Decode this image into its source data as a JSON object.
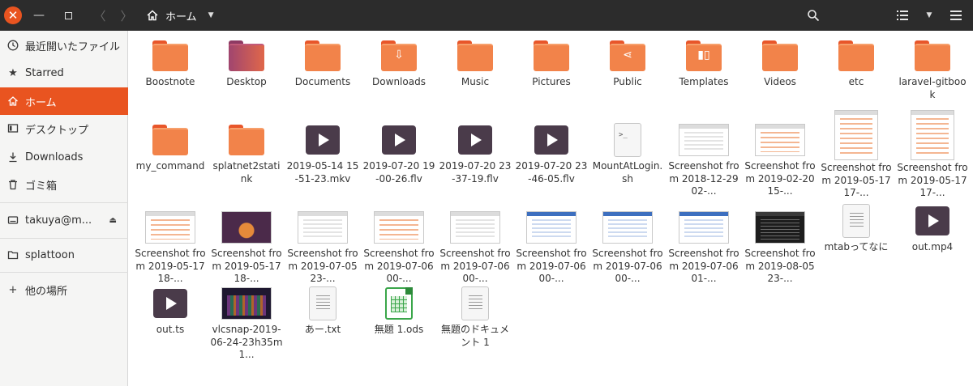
{
  "header": {
    "close_glyph": "✕",
    "minimize_glyph": "—",
    "back_glyph": "〈",
    "forward_glyph": "〉",
    "location_label": "ホーム",
    "location_caret": "▼",
    "view_caret": "▼"
  },
  "sidebar": {
    "items": [
      {
        "label": "最近開いたファイル",
        "icon": "recent-icon"
      },
      {
        "label": "Starred",
        "icon": "star-icon"
      },
      {
        "label": "ホーム",
        "icon": "home-icon",
        "active": true
      },
      {
        "label": "デスクトップ",
        "icon": "desktop-icon"
      },
      {
        "label": "Downloads",
        "icon": "download-icon"
      },
      {
        "label": "ゴミ箱",
        "icon": "trash-icon"
      },
      {
        "label": "takuya@m...",
        "icon": "drive-icon"
      },
      {
        "label": "splattoon",
        "icon": "folder-icon"
      },
      {
        "label": "他の場所",
        "icon": "plus-icon"
      }
    ],
    "eject_glyph": "⏏"
  },
  "files": [
    {
      "name": "Boostnote",
      "kind": "folder"
    },
    {
      "name": "Desktop",
      "kind": "folder-desktop"
    },
    {
      "name": "Documents",
      "kind": "folder"
    },
    {
      "name": "Downloads",
      "kind": "folder-download"
    },
    {
      "name": "Music",
      "kind": "folder-music"
    },
    {
      "name": "Pictures",
      "kind": "folder-pictures"
    },
    {
      "name": "Public",
      "kind": "folder-share"
    },
    {
      "name": "Templates",
      "kind": "folder-templates"
    },
    {
      "name": "Videos",
      "kind": "folder"
    },
    {
      "name": "etc",
      "kind": "folder"
    },
    {
      "name": "laravel-gitbook",
      "kind": "folder"
    },
    {
      "name": "my_command",
      "kind": "folder"
    },
    {
      "name": "splatnet2statink",
      "kind": "folder"
    },
    {
      "name": "2019-05-14 15-51-23.mkv",
      "kind": "video"
    },
    {
      "name": "2019-07-20 19-00-26.flv",
      "kind": "video"
    },
    {
      "name": "2019-07-20 23-37-19.flv",
      "kind": "video"
    },
    {
      "name": "2019-07-20 23-46-05.flv",
      "kind": "video"
    },
    {
      "name": "MountAtLogin.sh",
      "kind": "script"
    },
    {
      "name": "Screenshot from 2018-12-29 02-...",
      "kind": "shot"
    },
    {
      "name": "Screenshot from 2019-02-20 15-...",
      "kind": "shot-orange"
    },
    {
      "name": "Screenshot from 2019-05-17 17-...",
      "kind": "shot-tall"
    },
    {
      "name": "Screenshot from 2019-05-17 17-...",
      "kind": "shot-tall"
    },
    {
      "name": "Screenshot from 2019-05-17 18-...",
      "kind": "shot-orange"
    },
    {
      "name": "Screenshot from 2019-05-17 18-...",
      "kind": "shot-purple"
    },
    {
      "name": "Screenshot from 2019-07-05 23-...",
      "kind": "shot"
    },
    {
      "name": "Screenshot from 2019-07-06 00-...",
      "kind": "shot-orange"
    },
    {
      "name": "Screenshot from 2019-07-06 00-...",
      "kind": "shot"
    },
    {
      "name": "Screenshot from 2019-07-06 00-...",
      "kind": "shot-blue"
    },
    {
      "name": "Screenshot from 2019-07-06 00-...",
      "kind": "shot-blue"
    },
    {
      "name": "Screenshot from 2019-07-06 01-...",
      "kind": "shot-blue"
    },
    {
      "name": "Screenshot from 2019-08-05 23-...",
      "kind": "shot-dark"
    },
    {
      "name": "mtabってなに",
      "kind": "doc"
    },
    {
      "name": "out.mp4",
      "kind": "video"
    },
    {
      "name": "out.ts",
      "kind": "video"
    },
    {
      "name": "vlcsnap-2019-06-24-23h35m1...",
      "kind": "shot-game"
    },
    {
      "name": "あー.txt",
      "kind": "doc"
    },
    {
      "name": "無題 1.ods",
      "kind": "sheet"
    },
    {
      "name": "無題のドキュメント 1",
      "kind": "doc"
    }
  ],
  "colors": {
    "accent": "#e95420",
    "folder": "#f2834a",
    "headerbar": "#2c2c2c",
    "sidebar": "#f5f5f4"
  }
}
